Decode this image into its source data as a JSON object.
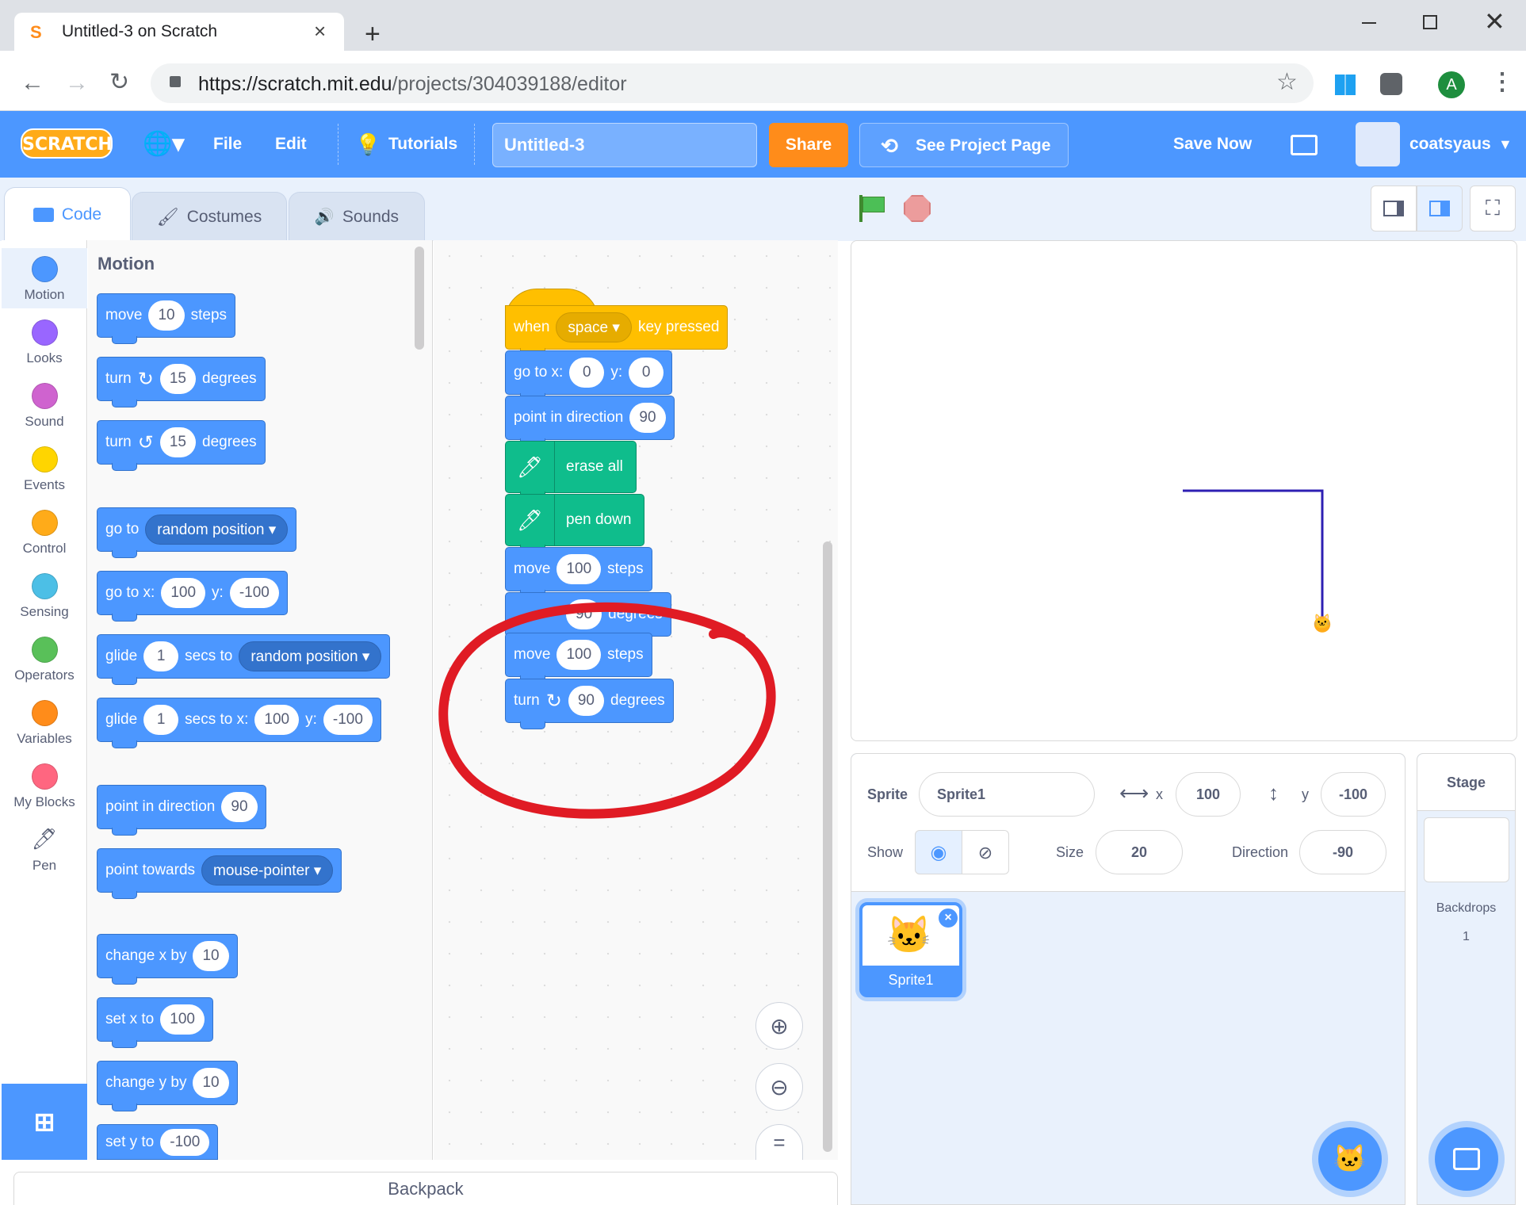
{
  "browser": {
    "tab_title": "Untitled-3 on Scratch",
    "new_tab": "+",
    "url_host": "https://scratch.mit.edu",
    "url_path": "/projects/304039188/editor",
    "avatar_letter": "A"
  },
  "menu": {
    "file": "File",
    "edit": "Edit",
    "tutorials": "Tutorials",
    "project_title": "Untitled-3",
    "share": "Share",
    "see_project_page": "See Project Page",
    "save_now": "Save Now",
    "username": "coatsyaus"
  },
  "editor_tabs": {
    "code": "Code",
    "costumes": "Costumes",
    "sounds": "Sounds"
  },
  "categories": [
    {
      "label": "Motion",
      "color": "#4c97ff"
    },
    {
      "label": "Looks",
      "color": "#9966ff"
    },
    {
      "label": "Sound",
      "color": "#cf63cf"
    },
    {
      "label": "Events",
      "color": "#ffd500"
    },
    {
      "label": "Control",
      "color": "#ffab19"
    },
    {
      "label": "Sensing",
      "color": "#4cbfe6"
    },
    {
      "label": "Operators",
      "color": "#59c059"
    },
    {
      "label": "Variables",
      "color": "#ff8c1a"
    },
    {
      "label": "My Blocks",
      "color": "#ff6680"
    },
    {
      "label": "Pen",
      "color": ""
    }
  ],
  "palette": {
    "heading": "Motion",
    "move": {
      "a": "move",
      "v": "10",
      "b": "steps"
    },
    "turn_cw": {
      "a": "turn",
      "v": "15",
      "b": "degrees"
    },
    "turn_ccw": {
      "a": "turn",
      "v": "15",
      "b": "degrees"
    },
    "goto": {
      "a": "go to",
      "d": "random position"
    },
    "gotoxy": {
      "a": "go to x:",
      "x": "100",
      "y_label": "y:",
      "y": "-100"
    },
    "glide": {
      "a": "glide",
      "v": "1",
      "b": "secs to",
      "d": "random position"
    },
    "glidexy": {
      "a": "glide",
      "v": "1",
      "b": "secs to x:",
      "x": "100",
      "y_label": "y:",
      "y": "-100"
    },
    "point_dir": {
      "a": "point in direction",
      "v": "90"
    },
    "point_towards": {
      "a": "point towards",
      "d": "mouse-pointer"
    },
    "change_x": {
      "a": "change x by",
      "v": "10"
    },
    "set_x": {
      "a": "set x to",
      "v": "100"
    },
    "change_y": {
      "a": "change y by",
      "v": "10"
    },
    "set_y": {
      "a": "set y to",
      "v": "-100"
    }
  },
  "script": {
    "hat": {
      "a": "when",
      "d": "space",
      "b": "key pressed"
    },
    "gotoxy": {
      "a": "go to x:",
      "x": "0",
      "y_label": "y:",
      "y": "0"
    },
    "point_dir": {
      "a": "point in direction",
      "v": "90"
    },
    "erase": "erase all",
    "pendown": "pen down",
    "move1": {
      "a": "move",
      "v": "100",
      "b": "steps"
    },
    "turn1": {
      "v": "90",
      "b": "degrees"
    },
    "move2": {
      "a": "move",
      "v": "100",
      "b": "steps"
    },
    "turn2": {
      "a": "turn",
      "v": "90",
      "b": "degrees"
    }
  },
  "backpack": "Backpack",
  "sprite_info": {
    "sprite_label": "Sprite",
    "sprite_name": "Sprite1",
    "x_label": "x",
    "x": "100",
    "y_label": "y",
    "y": "-100",
    "show_label": "Show",
    "size_label": "Size",
    "size": "20",
    "direction_label": "Direction",
    "direction": "-90"
  },
  "sprite_tile": {
    "name": "Sprite1"
  },
  "stage_panel": {
    "title": "Stage",
    "backdrops_label": "Backdrops",
    "backdrops_count": "1"
  }
}
